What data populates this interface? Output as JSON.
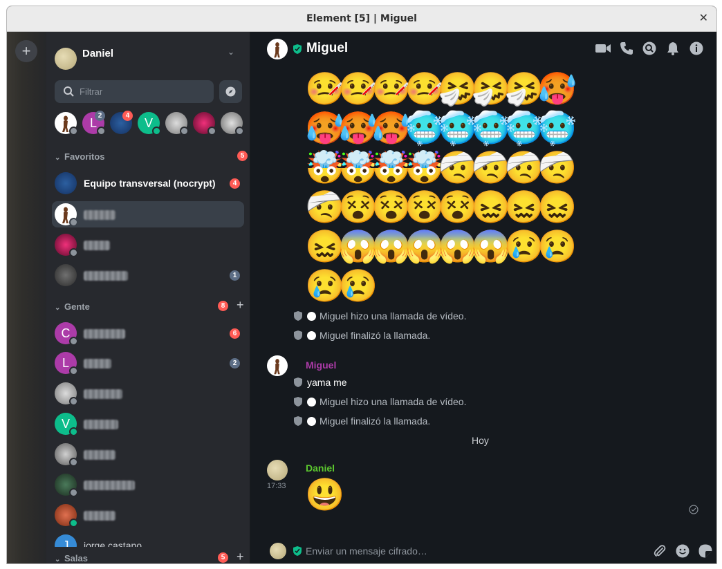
{
  "window": {
    "title": "Element [5] | Miguel",
    "close_icon": "✕"
  },
  "spaces": {
    "add_icon": "+"
  },
  "user": {
    "name": "Daniel"
  },
  "filter": {
    "placeholder": "Filtrar"
  },
  "recent_rooms": [
    {
      "initial": "",
      "color": "#ffffff",
      "badge": ""
    },
    {
      "initial": "L",
      "color": "#ac3ba8",
      "badge": "2"
    },
    {
      "initial": "",
      "color": "#1e4a8a",
      "badge": "4"
    },
    {
      "initial": "V",
      "color": "#0dbd8b",
      "badge": ""
    },
    {
      "initial": "",
      "color": "#9a9a9a",
      "badge": ""
    },
    {
      "initial": "",
      "color": "#d81b60",
      "badge": ""
    },
    {
      "initial": "",
      "color": "#c8c8c8",
      "badge": ""
    }
  ],
  "sections": {
    "favorites": {
      "label": "Favoritos",
      "badge": "5"
    },
    "people": {
      "label": "Gente",
      "badge": "8"
    },
    "rooms": {
      "label": "Salas",
      "badge": "5"
    }
  },
  "favorites": [
    {
      "name": "Equipo transversal (nocrypt)",
      "badge": "4",
      "badge_type": "red"
    },
    {
      "name": "",
      "badge": "",
      "badge_type": ""
    },
    {
      "name": "",
      "badge": "",
      "badge_type": ""
    },
    {
      "name": "",
      "badge": "1",
      "badge_type": "grey"
    }
  ],
  "people": [
    {
      "initial": "C",
      "color": "#ac3ba8",
      "badge": "6",
      "badge_type": "red"
    },
    {
      "initial": "L",
      "color": "#ac3ba8",
      "badge": "2",
      "badge_type": "grey"
    },
    {
      "initial": "",
      "color": "#9a9a9a",
      "badge": "",
      "badge_type": ""
    },
    {
      "initial": "V",
      "color": "#0dbd8b",
      "badge": "",
      "badge_type": ""
    },
    {
      "initial": "",
      "color": "#b0b0b0",
      "badge": "",
      "badge_type": ""
    },
    {
      "initial": "",
      "color": "#2e4a3a",
      "badge": "",
      "badge_type": ""
    },
    {
      "initial": "",
      "color": "#c05030",
      "badge": "",
      "badge_type": ""
    },
    {
      "initial": "J",
      "color": "#368bd6",
      "name": "jorge castano",
      "badge": "",
      "badge_type": ""
    }
  ],
  "chat": {
    "room_name": "Miguel",
    "emoji_rows": [
      [
        "🤒",
        "🤒",
        "🤒",
        "🤒",
        "🤧",
        "🤧",
        "🤧",
        "🥵"
      ],
      [
        "🥵",
        "🥵",
        "🥵",
        "🥶",
        "🥶",
        "🥶",
        "🥶",
        "🥶"
      ],
      [
        "🤯",
        "🤯",
        "🤯",
        "🤯",
        "🤕",
        "🤕",
        "🤕",
        "🤕"
      ],
      [
        "🤕",
        "😵",
        "😵",
        "😵",
        "😵",
        "😖",
        "😖",
        "😖"
      ],
      [
        "😖",
        "😱",
        "😱",
        "😱",
        "😱",
        "😱",
        "😢",
        "😢"
      ],
      [
        "😢",
        "😢"
      ]
    ],
    "events": [
      "Miguel hizo una llamada de vídeo.",
      "Miguel finalizó la llamada.",
      "Miguel hizo una llamada de vídeo.",
      "Miguel finalizó la llamada."
    ],
    "sender_miguel": "Miguel",
    "message_1": "yama me",
    "day_separator": "Hoy",
    "sender_daniel": "Daniel",
    "timestamp": "17:33",
    "message_2": "😃",
    "composer_placeholder": "Enviar un mensaje cifrado…"
  },
  "colors": {
    "accent_green": "#0dbd8b",
    "miguel_color": "#ac3ba8",
    "daniel_color": "#5cc92f",
    "badge_red": "#ff5b55"
  }
}
